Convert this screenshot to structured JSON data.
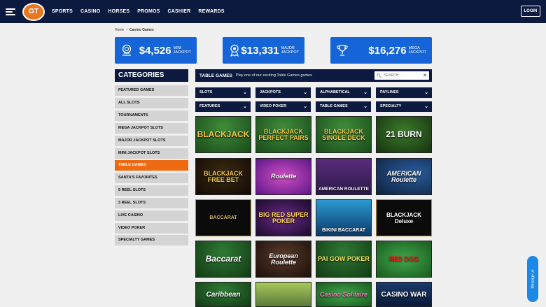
{
  "nav": {
    "logo_text": "GT",
    "items": [
      "SPORTS",
      "CASINO",
      "HORSES",
      "PROMOS",
      "CASHIER",
      "REWARDS"
    ],
    "login": "LOGIN"
  },
  "breadcrumb": {
    "home": "Home",
    "sep": "›",
    "current": "Casino Games"
  },
  "jackpots": [
    {
      "amount": "$4,526",
      "line1": "MINI",
      "line2": "JACKPOT",
      "icon": "medal-icon"
    },
    {
      "amount": "$13,331",
      "line1": "MAJOR",
      "line2": "JACKPOT",
      "icon": "ribbon-icon"
    },
    {
      "amount": "$16,276",
      "line1": "MEGA",
      "line2": "JACKPOT",
      "icon": "trophy-icon"
    }
  ],
  "categories": {
    "title": "CATEGORIES",
    "items": [
      "FEATURED GAMES",
      "ALL SLOTS",
      "TOURNAMENTS",
      "MEGA JACKPOT SLOTS",
      "MAJOR JACKPOT SLOTS",
      "MINI JACKPOT SLOTS",
      "TABLE GAMES",
      "SANTA'S FAVORITES",
      "5 REEL SLOTS",
      "3 REEL SLOTS",
      "LIVE CASINO",
      "VIDEO POKER",
      "SPECIALTY GAMES"
    ],
    "active": "TABLE GAMES"
  },
  "table_games": {
    "title": "TABLE GAMES",
    "subtitle": "Play one of our exciting Table Games games",
    "search_placeholder": "SEARCH..."
  },
  "filters": [
    [
      "SLOTS",
      "JACKPOTS",
      "ALPHABETICAL",
      "PAYLINES"
    ],
    [
      "FEATURES",
      "VIDEO POKER",
      "TABLE GAMES",
      "SPECIALTY"
    ]
  ],
  "games": [
    [
      "BLACKJACK",
      "BLACKJACK PERFECT PAIRS",
      "BLACKJACK SINGLE DECK",
      "21 BURN"
    ],
    [
      "BLACKJACK FREE BET",
      "Roulette",
      "AMERICAN ROULETTE",
      "AMERICAN Roulette"
    ],
    [
      "BACCARAT",
      "BIG RED SUPER POKER",
      "BIKINI BACCARAT",
      "BLACKJACK Deluxe"
    ],
    [
      "Baccarat",
      "European Roulette",
      "PAI GOW POKER",
      "RED DOG"
    ],
    [
      "Caribbean",
      "",
      "Casino Solitaire",
      "CASINO WAR"
    ]
  ],
  "colors": {
    "navy": "#0b1a3e",
    "jackpot_blue": "#1565d8",
    "active_orange": "#ee6a12",
    "category_gray": "#d4d4d4"
  },
  "message_us": "Message us"
}
